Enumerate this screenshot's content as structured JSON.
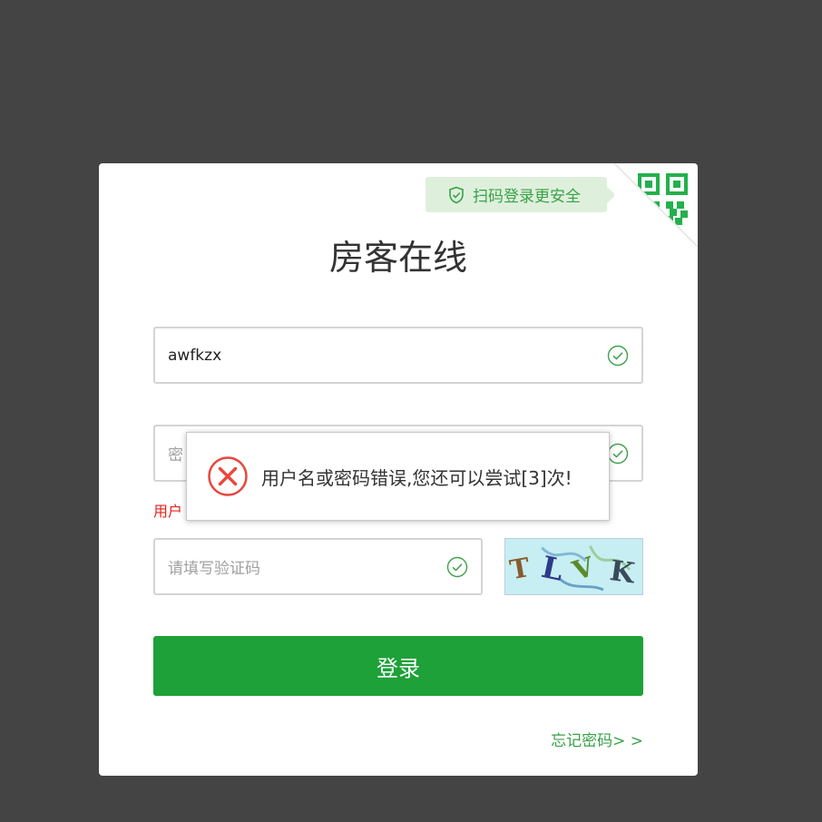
{
  "app": {
    "title": "房客在线"
  },
  "qr_login": {
    "tip": "扫码登录更安全",
    "icon": "qr-code-icon",
    "accent": "#3aa14a"
  },
  "form": {
    "username": {
      "value": "awfkzx",
      "status_icon": "check-circle-icon"
    },
    "password": {
      "placeholder": "密",
      "status_icon": "check-circle-icon"
    },
    "error_text": "用户",
    "captcha": {
      "placeholder": "请填写验证码",
      "status_icon": "check-circle-icon"
    },
    "submit_label": "登录",
    "forgot_label": "忘记密码> >"
  },
  "alert": {
    "message": "用户名或密码错误,您还可以尝试[3]次!",
    "icon": "error-circle-icon",
    "color": "#e8473c"
  },
  "colors": {
    "background": "#444444",
    "primary": "#1ea138",
    "error": "#e1251b"
  }
}
